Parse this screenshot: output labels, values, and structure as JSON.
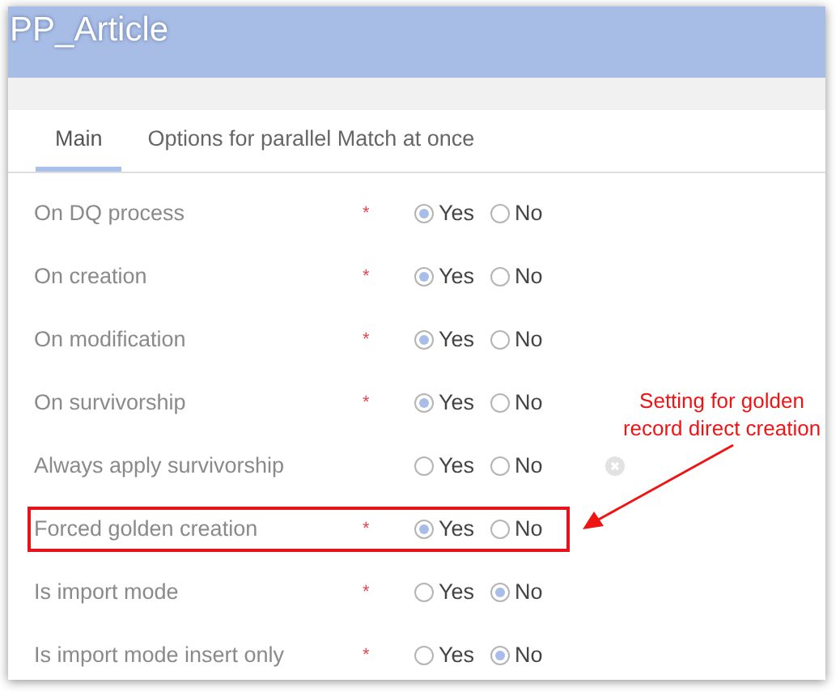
{
  "window": {
    "title": "PP_Article"
  },
  "tabs": [
    {
      "label": "Main",
      "selected": true
    },
    {
      "label": "Options for parallel Match at once",
      "selected": false
    }
  ],
  "fields": [
    {
      "label": "On DQ process",
      "required_mark": "*",
      "clearable": false,
      "highlighted": false,
      "options": [
        {
          "label": "Yes",
          "selected": true
        },
        {
          "label": "No",
          "selected": false
        }
      ]
    },
    {
      "label": "On creation",
      "required_mark": "*",
      "clearable": false,
      "highlighted": false,
      "options": [
        {
          "label": "Yes",
          "selected": true
        },
        {
          "label": "No",
          "selected": false
        }
      ]
    },
    {
      "label": "On modification",
      "required_mark": "*",
      "clearable": false,
      "highlighted": false,
      "options": [
        {
          "label": "Yes",
          "selected": true
        },
        {
          "label": "No",
          "selected": false
        }
      ]
    },
    {
      "label": "On survivorship",
      "required_mark": "*",
      "clearable": false,
      "highlighted": false,
      "options": [
        {
          "label": "Yes",
          "selected": true
        },
        {
          "label": "No",
          "selected": false
        }
      ]
    },
    {
      "label": "Always apply survivorship",
      "clearable": true,
      "highlighted": false,
      "options": [
        {
          "label": "Yes",
          "selected": false
        },
        {
          "label": "No",
          "selected": false
        }
      ]
    },
    {
      "label": "Forced golden creation",
      "required_mark": "*",
      "clearable": false,
      "highlighted": true,
      "options": [
        {
          "label": "Yes",
          "selected": true
        },
        {
          "label": "No",
          "selected": false
        }
      ]
    },
    {
      "label": "Is import mode",
      "required_mark": "*",
      "clearable": false,
      "highlighted": false,
      "options": [
        {
          "label": "Yes",
          "selected": false
        },
        {
          "label": "No",
          "selected": true
        }
      ]
    },
    {
      "label": "Is import mode insert only",
      "required_mark": "*",
      "clearable": false,
      "highlighted": false,
      "options": [
        {
          "label": "Yes",
          "selected": false
        },
        {
          "label": "No",
          "selected": true
        }
      ]
    }
  ],
  "annotation": {
    "text": "Setting for golden\nrecord direct creation"
  }
}
